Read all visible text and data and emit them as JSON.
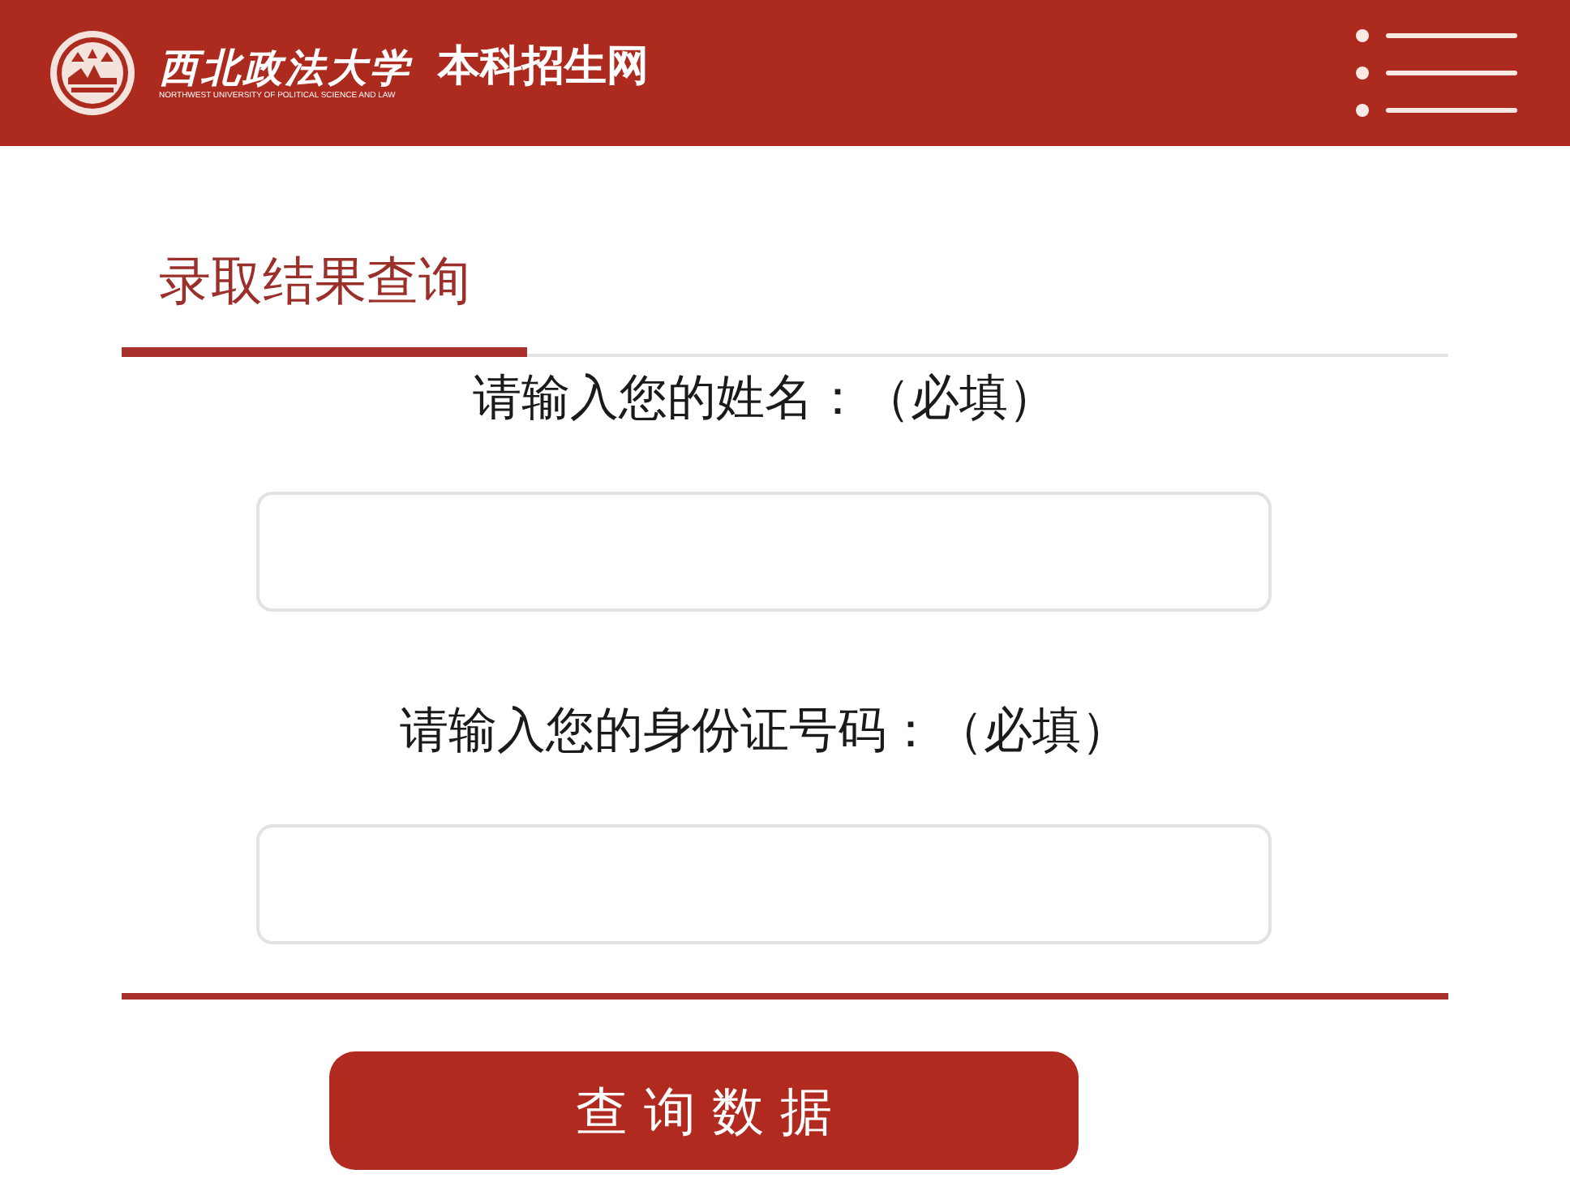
{
  "header": {
    "logo_title": "西北政法大学",
    "logo_subtitle": "NORTHWEST UNIVERSITY OF POLITICAL SCIENCE AND LAW",
    "site_name": "本科招生网"
  },
  "tabs": [
    {
      "label": "录取结果查询",
      "selected": true
    }
  ],
  "form": {
    "fields": [
      {
        "label": "请输入您的姓名：（必填）"
      },
      {
        "label": "请输入您的身份证号码：（必填）"
      }
    ]
  },
  "submit_button": "查询数据"
}
